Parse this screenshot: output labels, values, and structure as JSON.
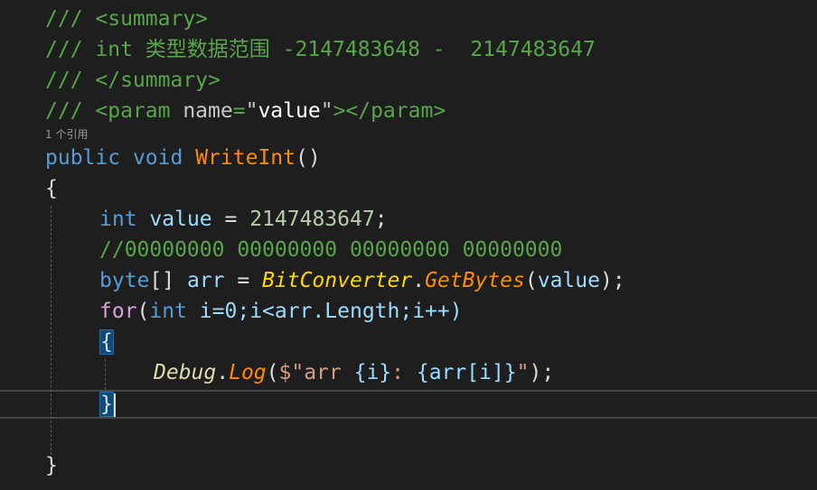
{
  "editor": {
    "lines": {
      "doc_summary_open": "/// <summary>",
      "doc_desc": "/// int 类型数据范围 -2147483648 -  2147483647",
      "doc_summary_close": "/// </summary>",
      "doc_param_prefix": "/// <param ",
      "doc_param_attr": "name",
      "doc_param_eq": "=",
      "doc_param_quote_open": "\"",
      "doc_param_value": "value",
      "doc_param_quote_close": "\"",
      "doc_param_suffix": "></param>",
      "codelens": "1 个引用",
      "kw_public": "public",
      "kw_void": "void",
      "method_name": "WriteInt",
      "parens": "()",
      "brace_open": "{",
      "kw_int": "int",
      "var_value": "value",
      "eq": " = ",
      "num_max": "2147483647",
      "semicolon": ";",
      "comment_bits": "//00000000 00000000 00000000 00000000",
      "kw_byte": "byte",
      "brackets": "[]",
      "var_arr": "arr",
      "class_bitconverter": "BitConverter",
      "dot": ".",
      "method_getbytes": "GetBytes",
      "arg_open": "(",
      "arg_value": "value",
      "arg_close": ");",
      "kw_for": "for",
      "for_open": "(",
      "for_int": "int",
      "for_rest": " i=0;i<arr.Length;i++)",
      "inner_brace_open": "{",
      "debug_class": "Debug",
      "log_method": "Log",
      "log_open": "(",
      "str_prefix": "$\"arr ",
      "interp_i": "{i}",
      "str_mid": ": ",
      "interp_arr": "{arr[i]}",
      "str_end": "\"",
      "log_close": ");",
      "inner_brace_close": "}",
      "brace_close": "}"
    }
  }
}
